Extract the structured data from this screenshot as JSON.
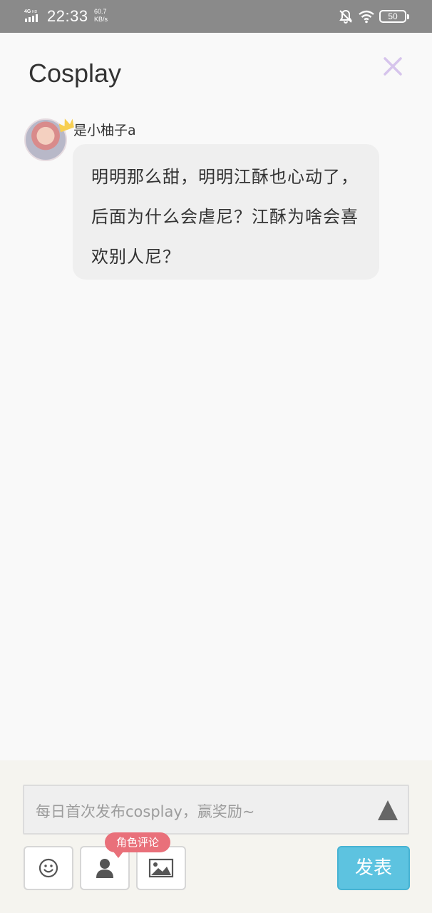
{
  "status_bar": {
    "network": "4GHD",
    "time": "22:33",
    "speed_value": "60.7",
    "speed_unit": "KB/s",
    "battery": "50",
    "icons": [
      "signal-icon",
      "mute-icon",
      "wifi-icon",
      "battery-icon"
    ]
  },
  "header": {
    "title": "Cosplay",
    "close_icon": "close-icon",
    "close_color": "#d6c4ec"
  },
  "comment": {
    "username": "是小柚子a",
    "text": "明明那么甜，明明江酥也心动了，后面为什么会虐尼？江酥为啥会喜欢别人尼？",
    "avatar_icon": "avatar",
    "badge_icon": "crown-icon"
  },
  "composer": {
    "placeholder": "每日首次发布cosplay，赢奖励~",
    "send_icon": "triangle-up-icon",
    "tools": [
      {
        "name": "emoji",
        "icon": "smiley-icon"
      },
      {
        "name": "role",
        "icon": "person-icon"
      },
      {
        "name": "image",
        "icon": "image-icon"
      }
    ],
    "role_tip": "角色评论",
    "publish_label": "发表",
    "accent_color": "#5dc3e0",
    "tip_color": "#e9707a"
  }
}
